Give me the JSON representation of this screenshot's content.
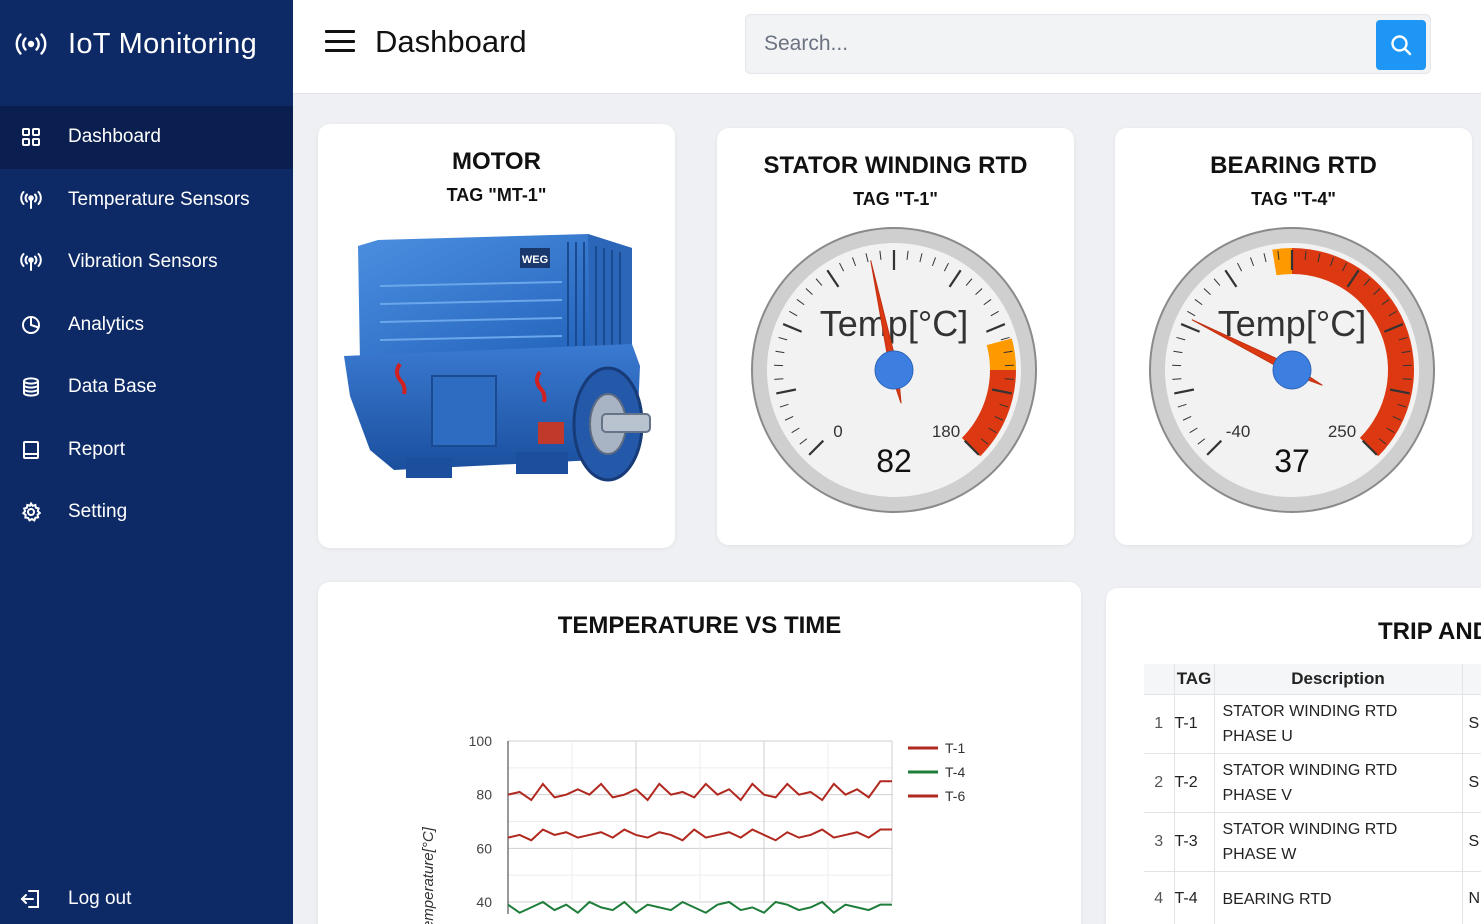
{
  "app": {
    "title": "IoT Monitoring"
  },
  "sidebar": {
    "items": [
      {
        "label": "Dashboard",
        "icon": "grid-icon",
        "active": true
      },
      {
        "label": "Temperature Sensors",
        "icon": "antenna-icon"
      },
      {
        "label": "Vibration Sensors",
        "icon": "antenna-icon"
      },
      {
        "label": "Analytics",
        "icon": "pie-chart-icon"
      },
      {
        "label": "Data Base",
        "icon": "database-icon"
      },
      {
        "label": "Report",
        "icon": "book-icon"
      },
      {
        "label": "Setting",
        "icon": "gear-icon"
      }
    ],
    "logout_label": "Log out"
  },
  "header": {
    "title": "Dashboard",
    "search_placeholder": "Search..."
  },
  "motor_card": {
    "title": "MOTOR",
    "tag": "TAG \"MT-1\"",
    "nameplate": "WEG"
  },
  "stator_gauge": {
    "title": "STATOR WINDING RTD",
    "tag": "TAG \"T-1\"",
    "label": "Temp[°C]",
    "min_label": "0",
    "max_label": "180",
    "value": "82",
    "min": 0,
    "max": 180,
    "reading": 82,
    "warn_from": 140,
    "alarm_from": 150
  },
  "bearing_gauge": {
    "title": "BEARING RTD",
    "tag": "TAG \"T-4\"",
    "label": "Temp[°C]",
    "min_label": "-40",
    "max_label": "250",
    "value": "37",
    "min": -40,
    "max": 250,
    "reading": 37,
    "warn_from": 95,
    "alarm_from": 105
  },
  "colors": {
    "sidebar": "#0d2a66",
    "sidebar_active": "#0a1f4f",
    "accent": "#1e96f5",
    "alarm": "#dc3912",
    "warning": "#ff9900",
    "needle": "#dc3912",
    "hub": "#3d7fe0",
    "series_red": "#b0281e",
    "series_green": "#1e7d3a"
  },
  "chart_data": {
    "type": "line",
    "title": "TEMPERATURE VS TIME",
    "ylabel": "Temperature[°C]",
    "xlabel": "",
    "ylim": [
      40,
      100
    ],
    "yticks": [
      40,
      60,
      80,
      100
    ],
    "grid": true,
    "legend": "right",
    "series": [
      {
        "name": "T-1",
        "color": "#b0281e",
        "values": [
          80,
          81,
          78,
          84,
          79,
          80,
          82,
          80,
          84,
          79,
          80,
          82,
          78,
          84,
          80,
          81,
          79,
          84,
          80,
          82,
          78,
          84,
          80,
          79,
          84,
          80,
          81,
          78,
          84,
          80,
          82,
          79,
          85,
          85
        ]
      },
      {
        "name": "T-4",
        "color": "#1e7d3a",
        "values": [
          39,
          36,
          38,
          40,
          37,
          39,
          36,
          40,
          38,
          37,
          40,
          36,
          39,
          38,
          37,
          40,
          38,
          36,
          39,
          40,
          37,
          38,
          36,
          40,
          39,
          37,
          38,
          40,
          36,
          39,
          38,
          37,
          39,
          39
        ]
      },
      {
        "name": "T-6",
        "color": "#b0281e",
        "values": [
          64,
          65,
          63,
          67,
          65,
          66,
          64,
          65,
          66,
          64,
          67,
          65,
          64,
          66,
          65,
          63,
          67,
          64,
          65,
          66,
          64,
          67,
          65,
          63,
          66,
          64,
          65,
          67,
          64,
          65,
          66,
          64,
          67,
          67
        ]
      }
    ]
  },
  "trip_table": {
    "title": "TRIP AND",
    "columns": [
      "",
      "TAG",
      "Description",
      ""
    ],
    "rows": [
      {
        "idx": "1",
        "tag": "T-1",
        "description": "STATOR WINDING RTD PHASE U",
        "extra": "S"
      },
      {
        "idx": "2",
        "tag": "T-2",
        "description": "STATOR WINDING RTD PHASE V",
        "extra": "S"
      },
      {
        "idx": "3",
        "tag": "T-3",
        "description": "STATOR WINDING RTD PHASE W",
        "extra": "S"
      },
      {
        "idx": "4",
        "tag": "T-4",
        "description": "BEARING RTD",
        "extra": "N E"
      }
    ]
  }
}
